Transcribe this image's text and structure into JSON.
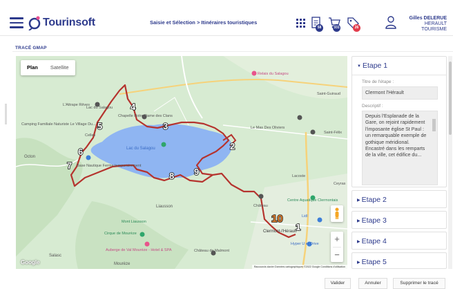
{
  "app": {
    "name": "Tourinsoft"
  },
  "breadcrumb": "Saisie et Sélection > Itinéraires touristiques",
  "toolbar": {
    "icons": [
      "apps-grid-icon",
      "document-icon",
      "cart-icon",
      "tag-icon"
    ],
    "badges": [
      "58",
      "331",
      "26"
    ]
  },
  "user": {
    "name": "Gilles DELERUE",
    "org": "HERAULT TOURISME"
  },
  "section_title": "TRACÉ GMAP",
  "map": {
    "types": [
      "Plan",
      "Satellite"
    ],
    "active_type": "Plan",
    "zoom_in": "+",
    "zoom_out": "−",
    "google_logo": "Google",
    "attribution": "Raccourcis clavier   Données cartographiques ©2022 Google   Conditions d'utilisation",
    "place_labels": [
      "Relais du Salagou",
      "Saint-Guiraud",
      "L'Attrape Rêves",
      "Lac du Salagou",
      "Chapelle Notre Dame des Clans",
      "Camping Familiale Naturiste Le Village Du...",
      "Celles",
      "Le Mas Des Oliviers",
      "Saint-Félix",
      "Octon",
      "Lac du Salagou",
      "Base Nautique Ferme temporairement",
      "Liausson",
      "Lacoste",
      "Ceyras",
      "Centre Aquatique Clermontais",
      "Château",
      "Mont Liausson",
      "Clermont-l'Hérault",
      "Lidl",
      "Cirque de Mourèze",
      "Auberge de Val Mourèze - Hotel & SPA",
      "Château de Malmont",
      "Hyper U et Drive",
      "Salasc",
      "Mourèze"
    ],
    "markers": [
      "1",
      "2",
      "3",
      "4",
      "5",
      "6",
      "7",
      "8",
      "9",
      "10"
    ],
    "route_color": "#b5332e",
    "lake_color": "#8fb5f2"
  },
  "steps": {
    "items": [
      "Etape 1",
      "Etape 2",
      "Etape 3",
      "Etape 4",
      "Etape 5"
    ],
    "open_index": 0,
    "title_label": "Titre de l'étape :",
    "title_value": "Clermont l'Hérault",
    "description_label": "Descriptif :",
    "description_value": "Depuis l'Esplanade de la Gare, on rejoint rapidement l'imposante église St Paul : un remarquable exemple de gothique méridional. Encastré dans les remparts de la ville, cet édifice du..."
  },
  "actions": {
    "validate": "Valider",
    "cancel": "Annuler",
    "delete_trace": "Supprimer le tracé"
  }
}
